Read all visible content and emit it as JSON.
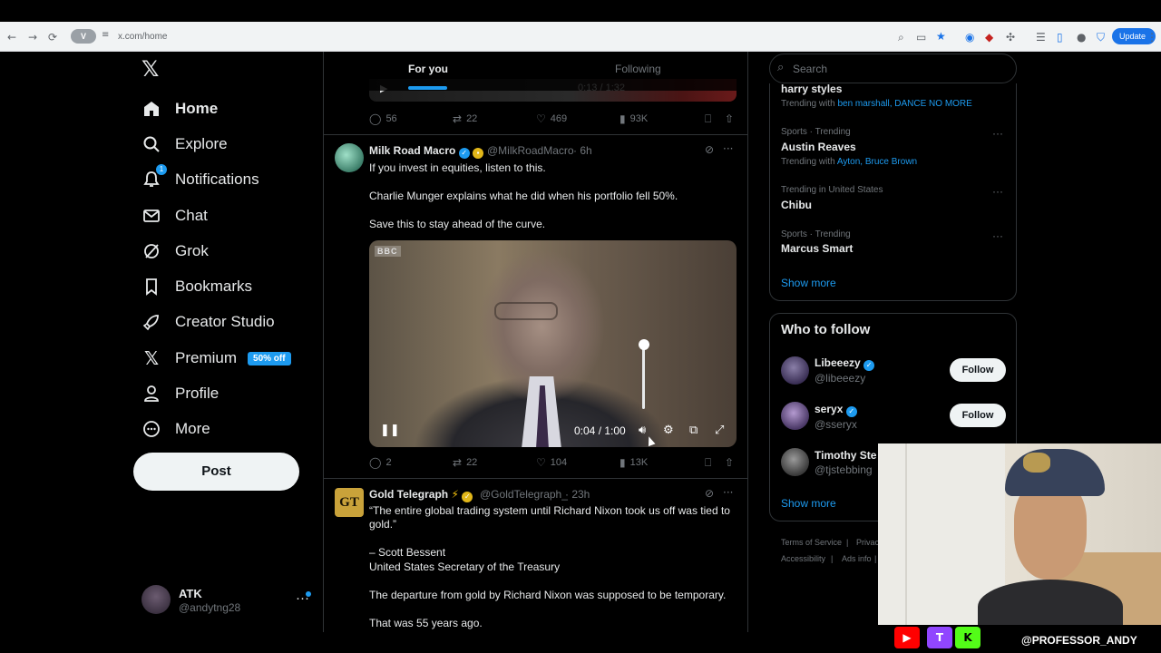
{
  "browser": {
    "back": "←",
    "forward": "→",
    "reload": "⟳",
    "vpn_badge": "V",
    "url": "x.com/home",
    "update_label": "Update"
  },
  "nav": {
    "items": [
      {
        "label": "Home",
        "icon": "home-icon"
      },
      {
        "label": "Explore",
        "icon": "search-icon"
      },
      {
        "label": "Notifications",
        "icon": "bell-icon",
        "badge": "1"
      },
      {
        "label": "Chat",
        "icon": "mail-icon"
      },
      {
        "label": "Grok",
        "icon": "grok-icon"
      },
      {
        "label": "Bookmarks",
        "icon": "bookmark-icon"
      },
      {
        "label": "Creator Studio",
        "icon": "rocket-icon"
      },
      {
        "label": "Premium",
        "icon": "x-icon",
        "promo": "50% off"
      },
      {
        "label": "Profile",
        "icon": "person-icon"
      },
      {
        "label": "More",
        "icon": "more-circle-icon"
      }
    ],
    "post_label": "Post",
    "account": {
      "name": "ATK",
      "handle": "@andytng28"
    }
  },
  "timeline": {
    "tabs": [
      "For you",
      "Following"
    ],
    "prev_stats": {
      "replies": "56",
      "reposts": "22",
      "likes": "469",
      "views": "93K"
    },
    "prev_video_time": "0:13 / 1:32",
    "tweets": [
      {
        "name": "Milk Road Macro",
        "handle": "@MilkRoadMacro",
        "time": "· 6h",
        "lines": [
          "If you invest in equities, listen to this.",
          "Charlie Munger explains what he did when his portfolio fell 50%.",
          "Save this to stay ahead of the curve."
        ],
        "video": {
          "logo": "BBC",
          "time": "0:04 / 1:00",
          "volume": 1.0
        },
        "stats": {
          "replies": "2",
          "reposts": "22",
          "likes": "104",
          "views": "13K"
        }
      },
      {
        "name": "Gold Telegraph",
        "handle": "@GoldTelegraph_",
        "time": "· 23h",
        "logo": "GT",
        "lines": [
          "“The entire global trading system until Richard Nixon took us off was tied to",
          "gold.”",
          "– Scott Bessent",
          "United States Secretary of the Treasury",
          "The departure from gold by Richard Nixon was supposed to be temporary.",
          "That was 55 years ago."
        ]
      }
    ]
  },
  "sidebar": {
    "search_placeholder": "Search",
    "trends": [
      {
        "name": "harry styles",
        "trending_prefix": "Trending with",
        "trending_with": "ben marshall, DANCE NO MORE"
      },
      {
        "context": "Sports · Trending",
        "name": "Austin Reaves",
        "trending_prefix": "Trending with",
        "trending_with": "Ayton, Bruce Brown"
      },
      {
        "context": "Trending in United States",
        "name": "Chibu"
      },
      {
        "context": "Sports · Trending",
        "name": "Marcus Smart"
      }
    ],
    "trend_more": "···",
    "show_more": "Show more",
    "who_to_follow": {
      "title": "Who to follow",
      "users": [
        {
          "name": "Libeeezy",
          "handle": "@libeeezy",
          "button": "Follow"
        },
        {
          "name": "seryx",
          "handle": "@sseryx",
          "button": "Follow"
        },
        {
          "name": "Timothy Ste",
          "handle": "@tjstebbing"
        }
      ],
      "show_more": "Show more"
    },
    "footer": [
      "Terms of Service",
      "|",
      "Privac",
      "Accessibility",
      "|",
      "Ads info",
      "|"
    ]
  },
  "overlay": {
    "social": [
      "▶",
      "T",
      "K"
    ],
    "handle": "@PROFESSOR_ANDY"
  }
}
